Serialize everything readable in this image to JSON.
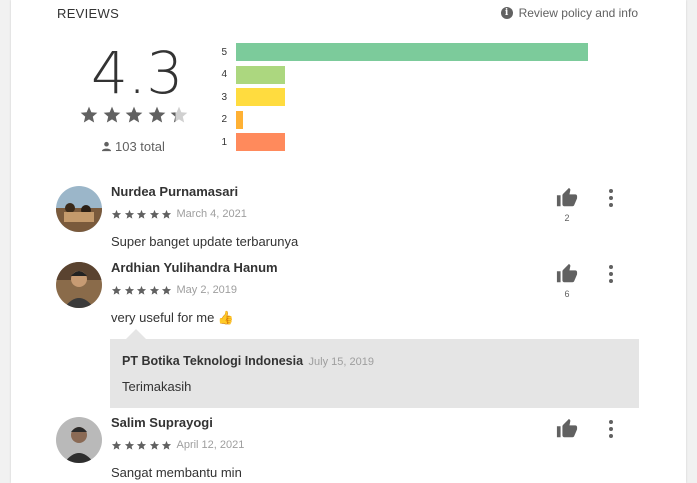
{
  "header": {
    "title": "REVIEWS",
    "policy_label": "Review policy and info"
  },
  "summary": {
    "average": "4.3",
    "stars": 4.3,
    "total": "103 total",
    "histogram": [
      {
        "label": "5",
        "fraction": 1.0,
        "color": "#7ccb9b"
      },
      {
        "label": "4",
        "fraction": 0.14,
        "color": "#acd77f"
      },
      {
        "label": "3",
        "fraction": 0.14,
        "color": "#ffdc3f"
      },
      {
        "label": "2",
        "fraction": 0.02,
        "color": "#ffb134"
      },
      {
        "label": "1",
        "fraction": 0.14,
        "color": "#ff8a5c"
      }
    ]
  },
  "reviews": [
    {
      "name": "Nurdea Purnamasari",
      "stars": 5,
      "date": "March 4, 2021",
      "text": "Super banget update terbarunya",
      "likes": "2"
    },
    {
      "name": "Ardhian Yulihandra Hanum",
      "stars": 5,
      "date": "May 2, 2019",
      "text": "very useful for me 👍",
      "likes": "6"
    },
    {
      "name": "Salim Suprayogi",
      "stars": 5,
      "date": "April 12, 2021",
      "text": "Sangat membantu min",
      "likes": ""
    }
  ],
  "reply": {
    "name": "PT Botika Teknologi Indonesia",
    "date": "July 15, 2019",
    "text": "Terimakasih"
  },
  "colors": {
    "star": "#616161",
    "star_empty": "#d0d0d0"
  }
}
